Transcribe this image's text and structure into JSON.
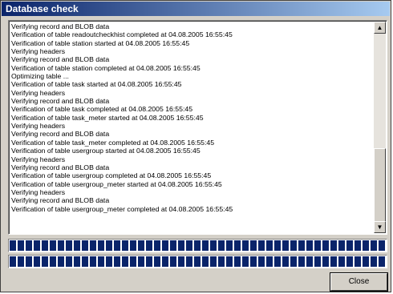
{
  "window": {
    "title": "Database check"
  },
  "log": {
    "lines": [
      "Verifying record and BLOB data",
      "Verification of table readoutcheckhist completed at 04.08.2005 16:55:45",
      "Verification of table station started at 04.08.2005 16:55:45",
      "Verifying headers",
      "Verifying record and BLOB data",
      "Verification of table station completed at 04.08.2005 16:55:45",
      "Optimizing table ...",
      "Verification of table task started at 04.08.2005 16:55:45",
      "Verifying headers",
      "Verifying record and BLOB data",
      "Verification of table task completed at 04.08.2005 16:55:45",
      "Verification of table task_meter started at 04.08.2005 16:55:45",
      "Verifying headers",
      "Verifying record and BLOB data",
      "Verification of table task_meter completed at 04.08.2005 16:55:45",
      "Verification of table usergroup started at 04.08.2005 16:55:45",
      "Verifying headers",
      "Verifying record and BLOB data",
      "Verification of table usergroup completed at 04.08.2005 16:55:45",
      "Verification of table usergroup_meter started at 04.08.2005 16:55:45",
      "Verifying headers",
      "Verifying record and BLOB data",
      "Verification of table usergroup_meter completed at 04.08.2005 16:55:45"
    ]
  },
  "scrollbar": {
    "up_arrow": "▲",
    "down_arrow": "▼"
  },
  "progress": [
    {
      "name": "progress-bar-1",
      "value": 1.0
    },
    {
      "name": "progress-bar-2",
      "value": 1.0
    }
  ],
  "buttons": {
    "close_label": "Close"
  },
  "colors": {
    "titlebar": "#0a246a",
    "progress_fill": "#0a246a",
    "face": "#d4d0c8"
  }
}
